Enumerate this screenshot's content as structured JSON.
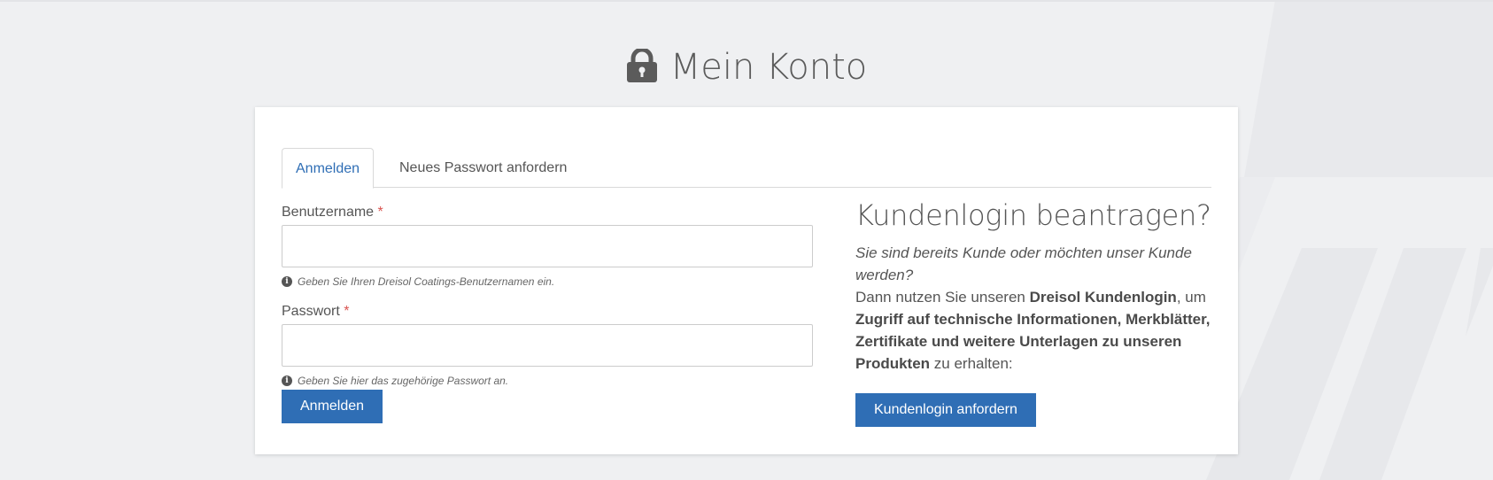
{
  "page": {
    "title": "Mein Konto",
    "title_icon": "lock-icon",
    "colors": {
      "primary": "#2f6eb5",
      "background": "#eff0f2",
      "required": "#d9534f"
    }
  },
  "tabs": [
    {
      "label": "Anmelden",
      "active": true
    },
    {
      "label": "Neues Passwort anfordern",
      "active": false
    }
  ],
  "login_form": {
    "username": {
      "label": "Benutzername",
      "required_marker": "*",
      "value": "",
      "help": "Geben Sie Ihren Dreisol Coatings-Benutzernamen ein.",
      "help_icon": "info-icon"
    },
    "password": {
      "label": "Passwort",
      "required_marker": "*",
      "value": "",
      "help": "Geben Sie hier das zugehörige Passwort an.",
      "help_icon": "info-icon"
    },
    "submit_label": "Anmelden"
  },
  "request_panel": {
    "title": "Kundenlogin beantragen?",
    "intro": "Sie sind bereits Kunde oder möchten unser Kunde werden?",
    "body": {
      "t1": "Dann nutzen Sie unseren ",
      "b1": "Dreisol Kundenlogin",
      "t2": ", um ",
      "b2": "Zugriff auf technische Informationen, Merkblätter, Zertifikate und weitere Unterlagen zu unseren Produkten",
      "t3": " zu erhalten:"
    },
    "button_label": "Kundenlogin anfordern"
  }
}
